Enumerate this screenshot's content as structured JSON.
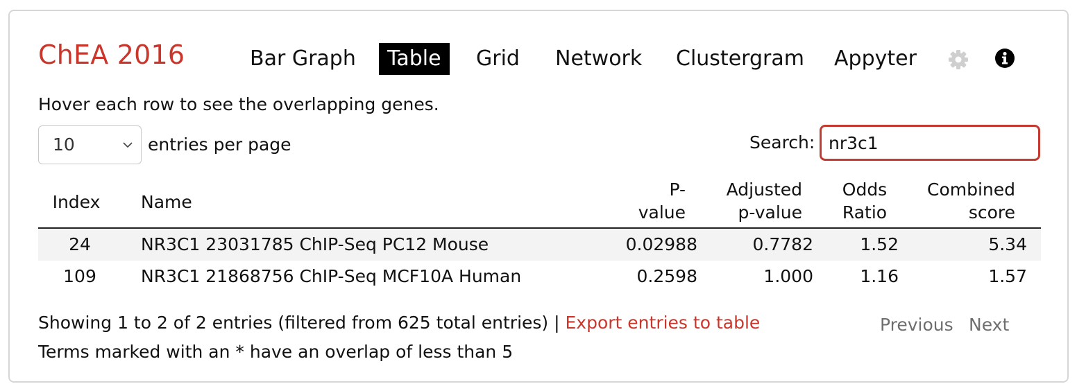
{
  "title": "ChEA 2016",
  "tabs": [
    {
      "label": "Bar Graph"
    },
    {
      "label": "Table"
    },
    {
      "label": "Grid"
    },
    {
      "label": "Network"
    },
    {
      "label": "Clustergram"
    },
    {
      "label": "Appyter"
    }
  ],
  "active_tab": "Table",
  "icons": {
    "settings": "gear-icon",
    "info": "info-icon"
  },
  "hint": "Hover each row to see the overlapping genes.",
  "page_size": {
    "selected": "10",
    "suffix": "entries per page"
  },
  "search": {
    "label": "Search:",
    "value": "nr3c1"
  },
  "table": {
    "columns": {
      "index": "Index",
      "name": "Name",
      "pvalue_1": "P-",
      "pvalue_2": "value",
      "adj_1": "Adjusted",
      "adj_2": "p-value",
      "odds_1": "Odds",
      "odds_2": "Ratio",
      "comb_1": "Combined",
      "comb_2": "score"
    },
    "rows": [
      {
        "index": "24",
        "name": "NR3C1 23031785 ChIP-Seq PC12 Mouse",
        "pvalue": "0.02988",
        "adjusted": "0.7782",
        "odds": "1.52",
        "combined": "5.34"
      },
      {
        "index": "109",
        "name": "NR3C1 21868756 ChIP-Seq MCF10A Human",
        "pvalue": "0.2598",
        "adjusted": "1.000",
        "odds": "1.16",
        "combined": "1.57"
      }
    ]
  },
  "footer": {
    "showing": "Showing 1 to 2 of 2 entries (filtered from 625 total entries) |",
    "export": "Export entries to table",
    "note": "Terms marked with an * have an overlap of less than 5"
  },
  "pagination": {
    "previous": "Previous",
    "next": "Next"
  },
  "colors": {
    "brand": "#c9372c",
    "search_border": "#c33b30",
    "pager_text": "#6e6e6e"
  }
}
